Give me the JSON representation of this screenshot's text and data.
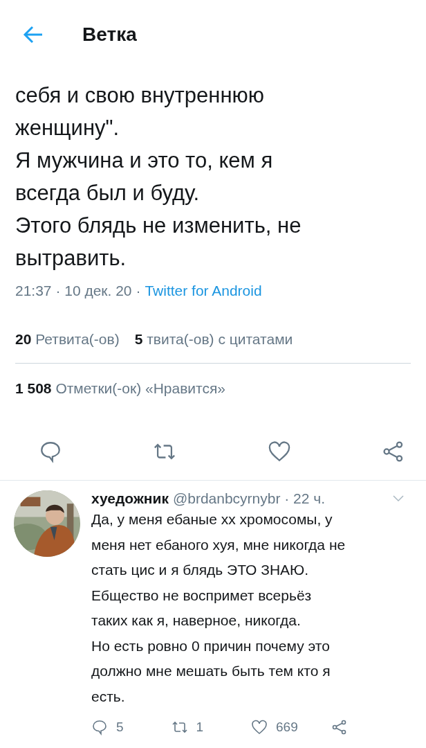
{
  "header": {
    "title": "Ветка"
  },
  "tweet": {
    "lines": [
      "себя и свою внутреннюю",
      "женщину\".",
      "Я мужчина и это то, кем я",
      "всегда был и буду.",
      "Этого блядь не изменить, не",
      "вытравить."
    ],
    "time": "21:37 · 10 дек. 20 ·",
    "source": "Twitter for Android",
    "stats": [
      {
        "count": "20",
        "label": "Ретвита(-ов)"
      },
      {
        "count": "5",
        "label": "твита(-ов) с цитатами"
      }
    ],
    "likes": {
      "count": "1 508",
      "label": "Отметки(-ок) «Нравится»"
    }
  },
  "reply": {
    "kind": "picture",
    "name": "хуедожник",
    "handle": "@brdanbcyrnybr · 22 ч.",
    "lines": [
      "Да, у меня ебаные хх хромосомы, у",
      "меня нет ебаного хуя, мне никогда не",
      "стать цис и я блядь ЭТО ЗНАЮ.",
      "Ебщество не воспримет всерьёз",
      "таких как я, наверное, никогда.",
      "Но есть ровно 0 причин почему это",
      "должно мне мешать быть тем кто я",
      "есть."
    ],
    "actions": [
      {
        "kind": "reply",
        "count": "5"
      },
      {
        "kind": "retweet",
        "count": "1"
      },
      {
        "kind": "like",
        "count": "669"
      },
      {
        "kind": "share"
      }
    ]
  }
}
